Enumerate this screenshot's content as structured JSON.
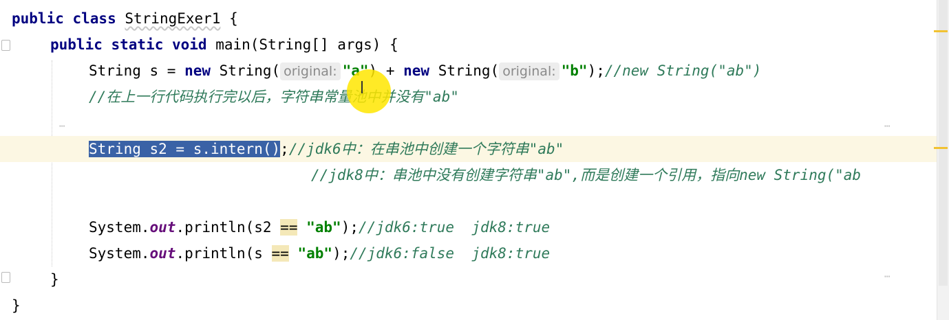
{
  "code": {
    "l1": {
      "kw": "public class",
      "name": "StringExer1",
      "brace": " {"
    },
    "l2": {
      "kw": "public static void",
      "rest": " main(String[] args) {"
    },
    "l3": {
      "type": "String s = ",
      "new1": "new",
      "cls1": " String(",
      "hint1": "original:",
      "str1": "\"a\"",
      "mid": ") + ",
      "new2": "new",
      "cls2": " String(",
      "hint2": "original:",
      "str2": "\"b\"",
      "end": ");",
      "comment": "//new String(\"ab\")"
    },
    "l4": {
      "comment": "//在上一行代码执行完以后，字符串常量池中并没有\"ab\""
    },
    "l6": {
      "selected": "String s2 = s.intern()",
      "end": ";",
      "comment": "//jdk6中：在串池中创建一个字符串\"ab\""
    },
    "l7": {
      "comment": "//jdk8中：串池中没有创建字符串\"ab\",而是创建一个引用，指向new String(\"ab"
    },
    "l9": {
      "pre": "System.",
      "field": "out",
      "mid": ".println(s2 ",
      "op": "==",
      "sp": " ",
      "str": "\"ab\"",
      "end": ");",
      "comment": "//jdk6:true  jdk8:true"
    },
    "l10": {
      "pre": "System.",
      "field": "out",
      "mid": ".println(s ",
      "op": "==",
      "sp": " ",
      "str": "\"ab\"",
      "end": ");",
      "comment": "//jdk6:false  jdk8:true"
    },
    "l11": {
      "brace": "}"
    },
    "l12": {
      "brace": "}"
    }
  },
  "colors": {
    "keyword": "#000080",
    "string": "#008000",
    "comment": "#808080",
    "selection": "#3a62a6",
    "current_line": "#fcf7e3"
  }
}
